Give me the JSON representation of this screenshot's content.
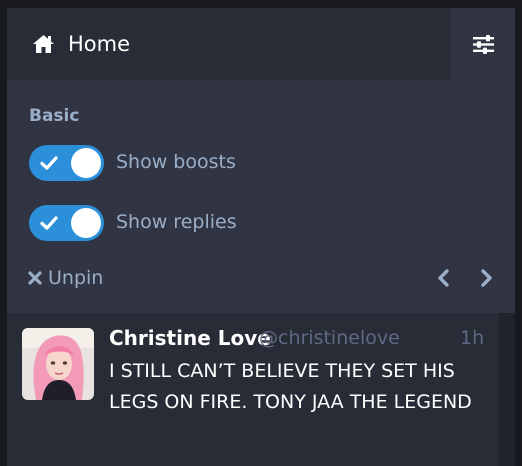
{
  "header": {
    "icon": "home-icon",
    "title": "Home",
    "settings_icon": "sliders-icon"
  },
  "settings": {
    "section_label": "Basic",
    "toggles": [
      {
        "label": "Show boosts",
        "checked": true
      },
      {
        "label": "Show replies",
        "checked": true
      }
    ],
    "unpin_label": "Unpin",
    "unpin_icon": "close-icon",
    "move_left_icon": "chevron-left-icon",
    "move_right_icon": "chevron-right-icon"
  },
  "status": {
    "display_name": "Christine Love",
    "username": "@christinelove",
    "time": "1h",
    "content": "I STILL CAN’T BELIEVE THEY SET HIS LEGS ON FIRE. TONY JAA THE LEGEND"
  },
  "colors": {
    "accent": "#2b90d9",
    "column_bg": "#282c37",
    "panel_bg": "#313543",
    "muted_text": "#9baec8",
    "dim_text": "#606984"
  }
}
